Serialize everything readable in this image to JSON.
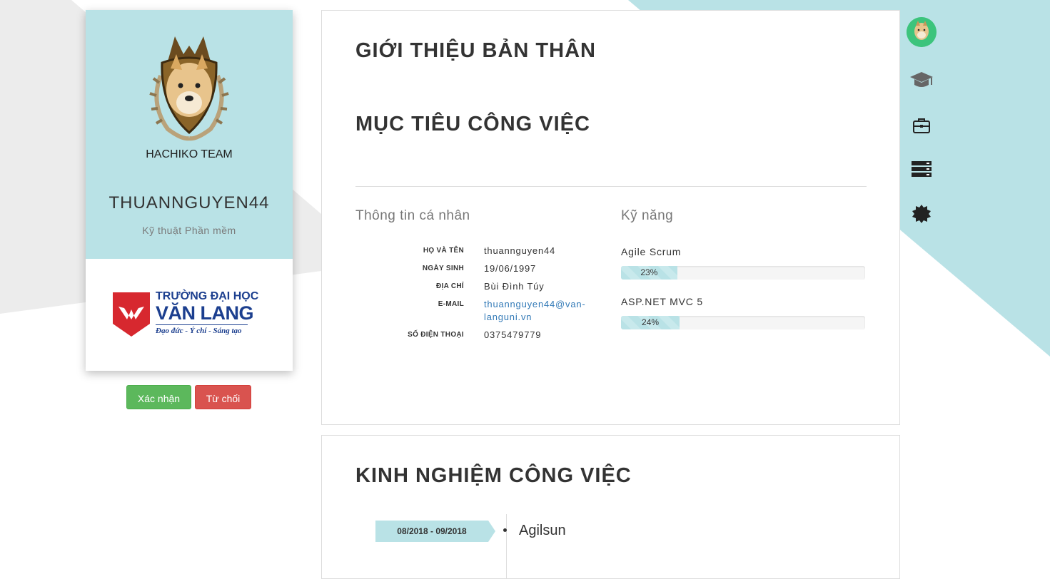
{
  "profile": {
    "logo_text": "HACHIKO TEAM",
    "name": "THUANNGUYEN44",
    "major": "Kỹ thuật Phần mềm",
    "university": {
      "line1": "TRƯỜNG ĐẠI HỌC",
      "line2": "VĂN LANG",
      "motto": "Đạo đức - Ý chí - Sáng tạo"
    }
  },
  "actions": {
    "confirm_label": "Xác nhận",
    "reject_label": "Từ chối"
  },
  "sections": {
    "about_title": "GIỚI THIỆU BẢN THÂN",
    "objective_title": "MỤC TIÊU CÔNG VIỆC",
    "experience_title": "KINH NGHIỆM CÔNG VIỆC"
  },
  "personal": {
    "heading": "Thông tin cá nhân",
    "rows": [
      {
        "label": "HỌ VÀ TÊN",
        "value": "thuannguyen44"
      },
      {
        "label": "NGÀY SINH",
        "value": "19/06/1997"
      },
      {
        "label": "ĐỊA CHỈ",
        "value": "Bùi Đình Túy"
      },
      {
        "label": "E-MAIL",
        "value_line1": "thuannguyen44@van-",
        "value_line2": "languni.vn"
      },
      {
        "label": "SỐ ĐIỆN THOẠI",
        "value": "0375479779"
      }
    ]
  },
  "skills": {
    "heading": "Kỹ năng",
    "items": [
      {
        "name": "Agile Scrum",
        "percent": 23,
        "percent_label": "23%"
      },
      {
        "name": "ASP.NET MVC 5",
        "percent": 24,
        "percent_label": "24%"
      }
    ]
  },
  "experience": {
    "items": [
      {
        "date": "08/2018 - 09/2018",
        "company": "Agilsun"
      }
    ]
  },
  "nav": {
    "icons": [
      "avatar",
      "graduation-cap-icon",
      "briefcase-icon",
      "server-icon",
      "badge-icon"
    ]
  },
  "colors": {
    "accent": "#b9e2e6",
    "confirm": "#5cb85c",
    "reject": "#d9534f",
    "link": "#337ab7"
  }
}
